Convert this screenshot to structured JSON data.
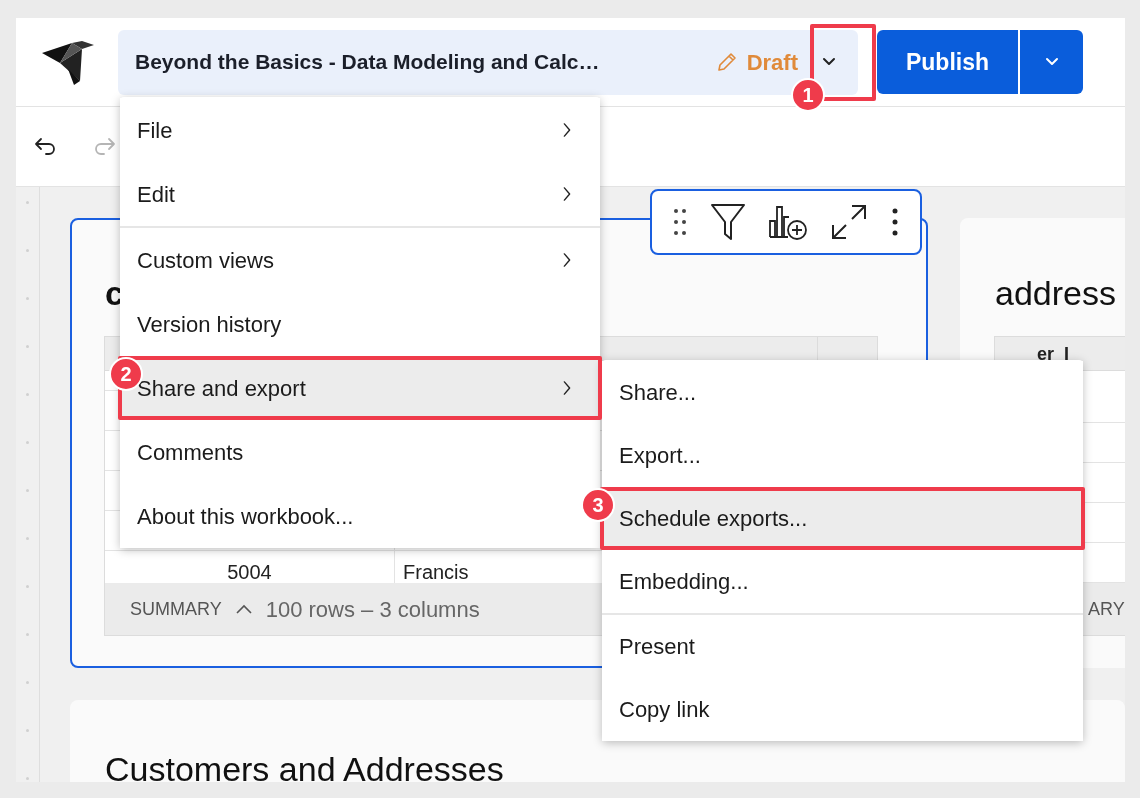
{
  "header": {
    "title": "Beyond the Basics - Data Modeling and Calc…",
    "status": "Draft",
    "publish": "Publish"
  },
  "toolbar": {
    "undo": {
      "disabled": false
    },
    "redo": {
      "disabled": true
    }
  },
  "cards": [
    {
      "title": "c",
      "selected": true,
      "rows": [
        [
          "5004",
          "Francis"
        ]
      ],
      "summary_label": "SUMMARY",
      "summary": "100 rows – 3 columns"
    },
    {
      "title": "address",
      "selected": false,
      "column": "er_I",
      "summary_label": "ARY"
    }
  ],
  "section_title": "Customers and Addresses",
  "menu": {
    "groups": [
      [
        {
          "label": "File",
          "submenu": true,
          "highlighted": false
        },
        {
          "label": "Edit",
          "submenu": true,
          "highlighted": false
        }
      ],
      [
        {
          "label": "Custom views",
          "submenu": true,
          "highlighted": false
        },
        {
          "label": "Version history",
          "submenu": false,
          "highlighted": false
        },
        {
          "label": "Share and export",
          "submenu": true,
          "highlighted": true
        },
        {
          "label": "Comments",
          "submenu": false,
          "highlighted": false
        },
        {
          "label": "About this workbook...",
          "submenu": false,
          "highlighted": false
        }
      ]
    ]
  },
  "submenu": {
    "groups": [
      [
        {
          "label": "Share...",
          "highlighted": false
        },
        {
          "label": "Export...",
          "highlighted": false
        },
        {
          "label": "Schedule exports...",
          "highlighted": true
        },
        {
          "label": "Embedding...",
          "highlighted": false
        }
      ],
      [
        {
          "label": "Present",
          "highlighted": false
        },
        {
          "label": "Copy link",
          "highlighted": false
        }
      ]
    ]
  },
  "callouts": [
    {
      "number": "1"
    },
    {
      "number": "2"
    },
    {
      "number": "3"
    }
  ]
}
